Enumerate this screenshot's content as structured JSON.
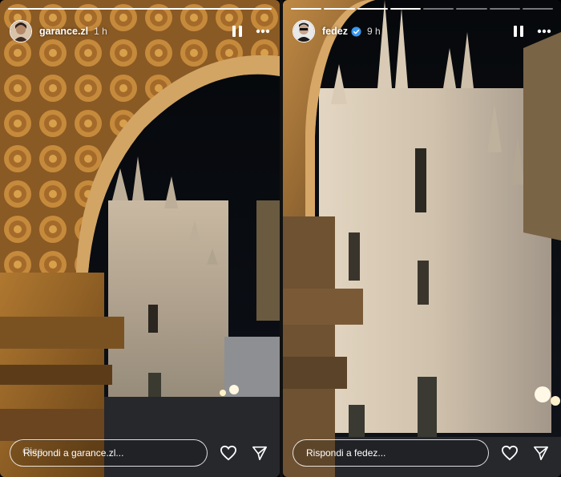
{
  "stories": [
    {
      "username": "garance.zl",
      "verified": false,
      "time": "1 h",
      "progress_segments": 1,
      "progress_complete": 1,
      "reply_placeholder": "Rispondi a garance.zl...",
      "sticker_text": "Ciao"
    },
    {
      "username": "fedez",
      "verified": true,
      "time": "9 h",
      "progress_segments": 8,
      "progress_complete": 4,
      "reply_placeholder": "Rispondi a fedez..."
    }
  ],
  "colors": {
    "verified": "#3897f0",
    "text": "#ffffff"
  },
  "icons": {
    "pause": "pause-icon",
    "more": "more-options-icon",
    "like": "heart-icon",
    "share": "send-icon"
  }
}
